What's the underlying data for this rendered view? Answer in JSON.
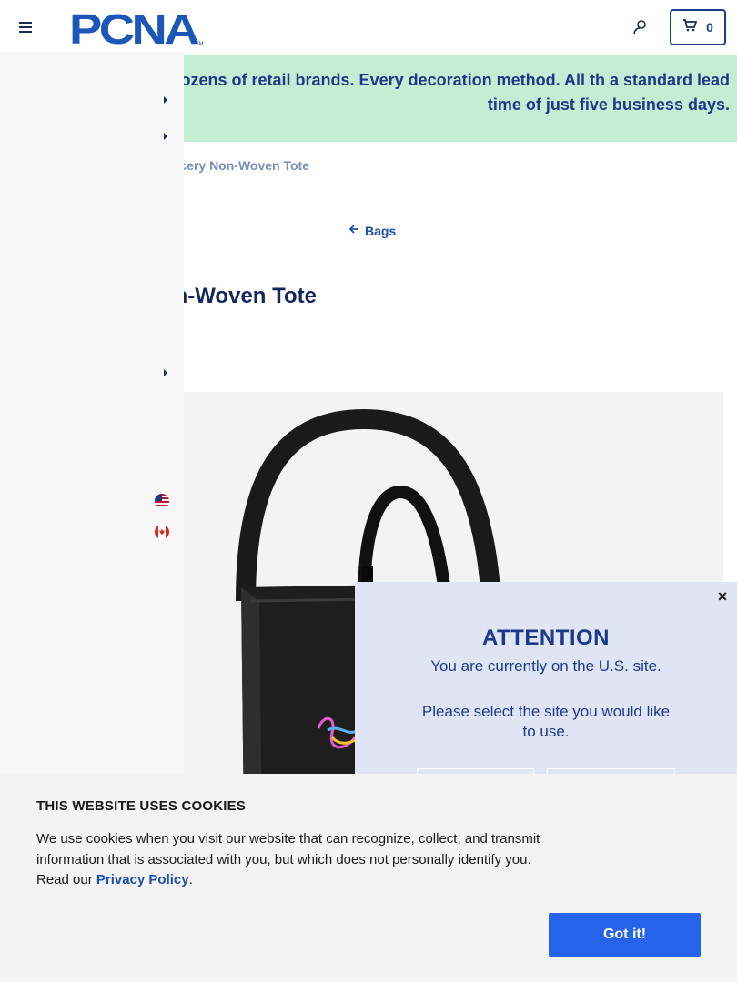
{
  "header": {
    "logo_text": "PCNA",
    "logo_tm": "TM",
    "cart_count": "0",
    "menu_icon": "hamburger-menu-icon",
    "account_icon": "user-account-icon",
    "cart_icon": "shopping-cart-icon"
  },
  "promo": {
    "text": "ls of products. Dozens of retail brands. Every decoration method. All th a standard lead time of just five business days."
  },
  "breadcrumb": {
    "current": "cery Non-Woven Tote"
  },
  "back_link": {
    "label": "Bags",
    "icon": "arrow-left-icon"
  },
  "product": {
    "title": "n-Woven Tote",
    "image_icon": "black-tote-bag-image"
  },
  "side_nav": {
    "flags": [
      "us-flag-icon",
      "canada-flag-icon"
    ]
  },
  "modal": {
    "close_label": "×",
    "title": "ATTENTION",
    "current_site": "You are currently on the U.S. site.",
    "select_prompt": "Please select the site you would like to use."
  },
  "cookie": {
    "title": "THIS WEBSITE USES COOKIES",
    "body": "We use cookies when you visit our website that can recognize, collect, and transmit information that is associated with you, but which does not personally identify you. Read our ",
    "link": "Privacy Policy",
    "period": ".",
    "button": "Got it!"
  },
  "colors": {
    "brand_blue": "#1b3f8b",
    "promo_green": "#c4eed4",
    "button_blue": "#2563eb",
    "modal_bg": "#dfe5f2"
  }
}
